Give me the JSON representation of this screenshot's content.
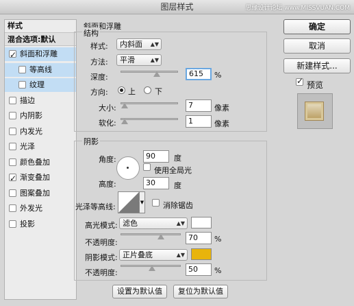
{
  "window": {
    "title": "图层样式",
    "watermark": "思缘设计论坛 www.MISSVUAN.COM"
  },
  "left_panel": {
    "header": "样式",
    "blend_options": "混合选项:默认",
    "items": [
      {
        "label": "斜面和浮雕",
        "checked": true,
        "selected": true,
        "indent": false
      },
      {
        "label": "等高线",
        "checked": false,
        "selected": true,
        "indent": true
      },
      {
        "label": "纹理",
        "checked": false,
        "selected": true,
        "indent": true
      },
      {
        "label": "描边",
        "checked": false,
        "selected": false,
        "indent": false
      },
      {
        "label": "内阴影",
        "checked": false,
        "selected": false,
        "indent": false
      },
      {
        "label": "内发光",
        "checked": false,
        "selected": false,
        "indent": false
      },
      {
        "label": "光泽",
        "checked": false,
        "selected": false,
        "indent": false
      },
      {
        "label": "颜色叠加",
        "checked": false,
        "selected": false,
        "indent": false
      },
      {
        "label": "渐变叠加",
        "checked": true,
        "selected": false,
        "indent": false
      },
      {
        "label": "图案叠加",
        "checked": false,
        "selected": false,
        "indent": false
      },
      {
        "label": "外发光",
        "checked": false,
        "selected": false,
        "indent": false
      },
      {
        "label": "投影",
        "checked": false,
        "selected": false,
        "indent": false
      }
    ]
  },
  "bevel": {
    "section_title": "斜面和浮雕",
    "structure_title": "结构",
    "style_label": "样式:",
    "style_value": "内斜面",
    "method_label": "方法:",
    "method_value": "平滑",
    "depth_label": "深度:",
    "depth_value": "615",
    "depth_unit": "%",
    "direction_label": "方向:",
    "direction_up": "上",
    "direction_down": "下",
    "size_label": "大小:",
    "size_value": "7",
    "size_unit": "像素",
    "soften_label": "软化:",
    "soften_value": "1",
    "soften_unit": "像素",
    "shading_title": "阴影",
    "angle_label": "角度:",
    "angle_value": "90",
    "angle_unit": "度",
    "global_light_label": "使用全局光",
    "altitude_label": "高度:",
    "altitude_value": "30",
    "altitude_unit": "度",
    "gloss_contour_label": "光泽等高线:",
    "antialias_label": "消除锯齿",
    "highlight_mode_label": "高光模式:",
    "highlight_mode_value": "滤色",
    "highlight_color": "#ffffff",
    "highlight_opacity_label": "不透明度:",
    "highlight_opacity_value": "70",
    "highlight_opacity_unit": "%",
    "shadow_mode_label": "阴影模式:",
    "shadow_mode_value": "正片叠底",
    "shadow_color": "#e8b40c",
    "shadow_opacity_label": "不透明度:",
    "shadow_opacity_value": "50",
    "shadow_opacity_unit": "%",
    "make_default": "设置为默认值",
    "reset_default": "复位为默认值"
  },
  "right_panel": {
    "ok": "确定",
    "cancel": "取消",
    "new_style": "新建样式...",
    "preview_label": "预览"
  }
}
